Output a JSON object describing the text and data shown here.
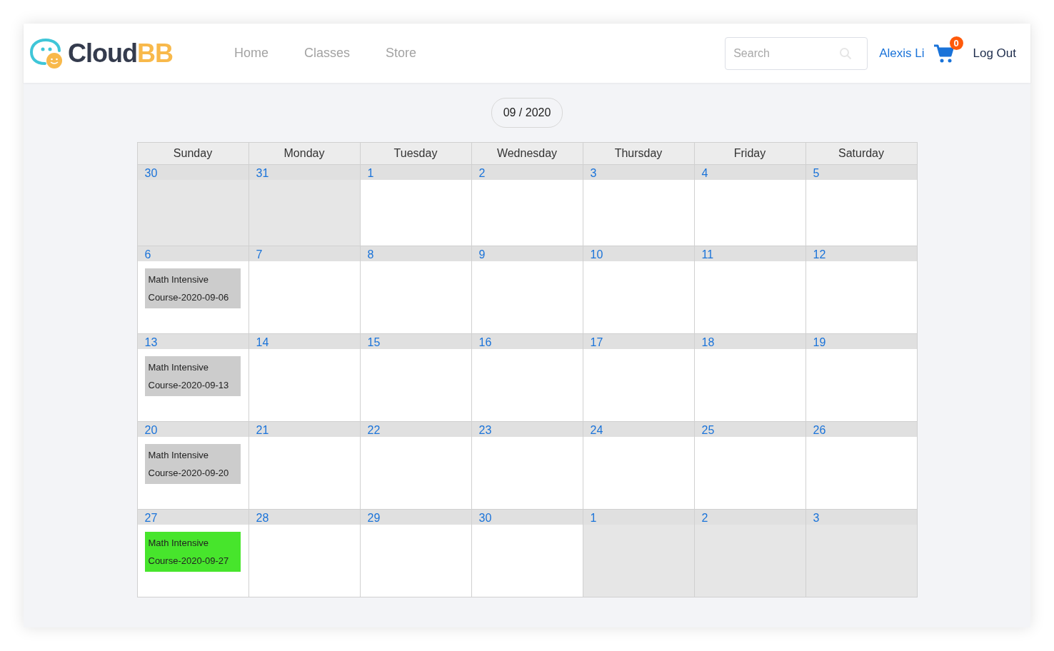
{
  "logo": {
    "word": "Cloud",
    "accent": "BB"
  },
  "nav": [
    {
      "label": "Home"
    },
    {
      "label": "Classes"
    },
    {
      "label": "Store"
    }
  ],
  "search": {
    "placeholder": "Search"
  },
  "user": "Alexis Li",
  "cart": {
    "count": "0"
  },
  "logout": "Log Out",
  "month": "09 / 2020",
  "weekdays": [
    "Sunday",
    "Monday",
    "Tuesday",
    "Wednesday",
    "Thursday",
    "Friday",
    "Saturday"
  ],
  "weeks": [
    [
      {
        "day": "30",
        "outside": true
      },
      {
        "day": "31",
        "outside": true
      },
      {
        "day": "1",
        "outside": false
      },
      {
        "day": "2",
        "outside": false
      },
      {
        "day": "3",
        "outside": false
      },
      {
        "day": "4",
        "outside": false
      },
      {
        "day": "5",
        "outside": false
      }
    ],
    [
      {
        "day": "6",
        "outside": false,
        "events": [
          {
            "title": "Math Intensive Course-2020-09-06",
            "color": "#cccccc"
          }
        ]
      },
      {
        "day": "7",
        "outside": false
      },
      {
        "day": "8",
        "outside": false
      },
      {
        "day": "9",
        "outside": false
      },
      {
        "day": "10",
        "outside": false
      },
      {
        "day": "11",
        "outside": false
      },
      {
        "day": "12",
        "outside": false
      }
    ],
    [
      {
        "day": "13",
        "outside": false,
        "events": [
          {
            "title": "Math Intensive Course-2020-09-13",
            "color": "#cccccc"
          }
        ]
      },
      {
        "day": "14",
        "outside": false
      },
      {
        "day": "15",
        "outside": false
      },
      {
        "day": "16",
        "outside": false
      },
      {
        "day": "17",
        "outside": false
      },
      {
        "day": "18",
        "outside": false
      },
      {
        "day": "19",
        "outside": false
      }
    ],
    [
      {
        "day": "20",
        "outside": false,
        "events": [
          {
            "title": "Math Intensive Course-2020-09-20",
            "color": "#cccccc"
          }
        ]
      },
      {
        "day": "21",
        "outside": false
      },
      {
        "day": "22",
        "outside": false
      },
      {
        "day": "23",
        "outside": false
      },
      {
        "day": "24",
        "outside": false
      },
      {
        "day": "25",
        "outside": false
      },
      {
        "day": "26",
        "outside": false
      }
    ],
    [
      {
        "day": "27",
        "outside": false,
        "events": [
          {
            "title": "Math Intensive Course-2020-09-27",
            "color": "#47e52c"
          }
        ]
      },
      {
        "day": "28",
        "outside": false
      },
      {
        "day": "29",
        "outside": false
      },
      {
        "day": "30",
        "outside": false
      },
      {
        "day": "1",
        "outside": true
      },
      {
        "day": "2",
        "outside": true
      },
      {
        "day": "3",
        "outside": true
      }
    ]
  ]
}
